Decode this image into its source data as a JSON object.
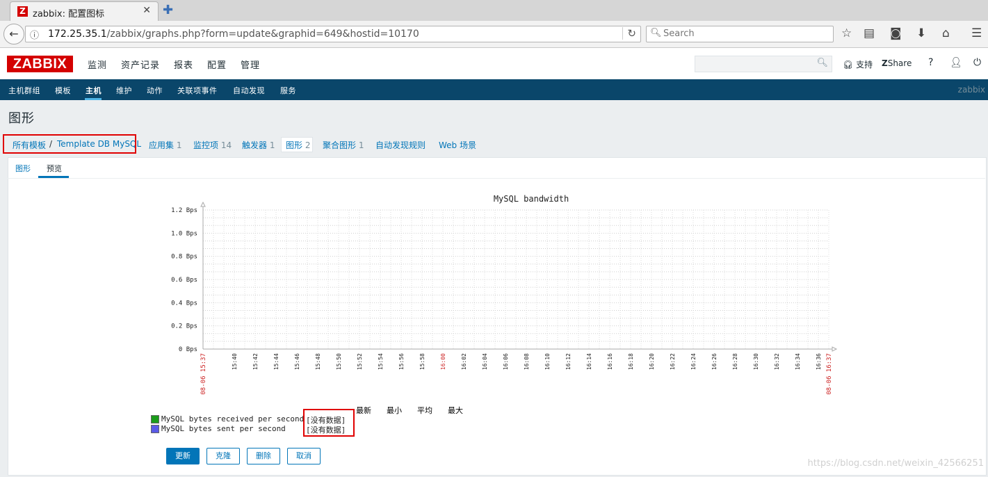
{
  "browser": {
    "tab_title": "zabbix: 配置图标",
    "url_host": "172.25.35.1",
    "url_path": "/zabbix/graphs.php?form=update&graphid=649&hostid=10170",
    "search_placeholder": "Search"
  },
  "header": {
    "logo": "ZABBIX",
    "menu": [
      "监测",
      "资产记录",
      "报表",
      "配置",
      "管理"
    ],
    "support": "支持",
    "share": "Share",
    "help": "?"
  },
  "submenu": {
    "items": [
      "主机群组",
      "模板",
      "主机",
      "维护",
      "动作",
      "关联项事件",
      "自动发现",
      "服务"
    ],
    "active_index": 2,
    "right_label": "zabbix"
  },
  "page": {
    "title": "图形"
  },
  "breadcrumbs": {
    "all_templates": "所有模板",
    "separator": "/",
    "template": "Template DB MySQL",
    "items": [
      {
        "label": "应用集",
        "count": "1"
      },
      {
        "label": "监控项",
        "count": "14"
      },
      {
        "label": "触发器",
        "count": "1"
      },
      {
        "label": "图形",
        "count": "2"
      },
      {
        "label": "聚合图形",
        "count": "1"
      },
      {
        "label": "自动发现规则",
        "count": ""
      },
      {
        "label": "Web 场景",
        "count": ""
      }
    ]
  },
  "form_tabs": {
    "graph": "图形",
    "preview": "预览"
  },
  "chart_data": {
    "type": "line",
    "title": "MySQL bandwidth",
    "y_ticks": [
      "1.2 Bps",
      "1.0 Bps",
      "0.8 Bps",
      "0.6 Bps",
      "0.4 Bps",
      "0.2 Bps",
      "0 Bps"
    ],
    "ylim": [
      0,
      1.2
    ],
    "x_start": "08-06 15:37",
    "x_end": "08-06 16:37",
    "x_ticks": [
      "15:40",
      "15:42",
      "15:44",
      "15:46",
      "15:48",
      "15:50",
      "15:52",
      "15:54",
      "15:56",
      "15:58",
      "16:00",
      "16:02",
      "16:04",
      "16:06",
      "16:08",
      "16:10",
      "16:12",
      "16:14",
      "16:16",
      "16:18",
      "16:20",
      "16:22",
      "16:24",
      "16:26",
      "16:28",
      "16:30",
      "16:32",
      "16:34",
      "16:36"
    ],
    "highlight_tick": "16:00",
    "grid": true,
    "series": [
      {
        "name": "MySQL bytes received per second",
        "color": "#1a9c1a",
        "values": []
      },
      {
        "name": "MySQL bytes sent per second",
        "color": "#5a5ae6",
        "values": []
      }
    ],
    "legend_columns": [
      "最新",
      "最小",
      "平均",
      "最大"
    ],
    "no_data": "[没有数据]"
  },
  "buttons": {
    "update": "更新",
    "clone": "克隆",
    "delete": "删除",
    "cancel": "取消"
  },
  "watermark": "https://blog.csdn.net/weixin_42566251"
}
